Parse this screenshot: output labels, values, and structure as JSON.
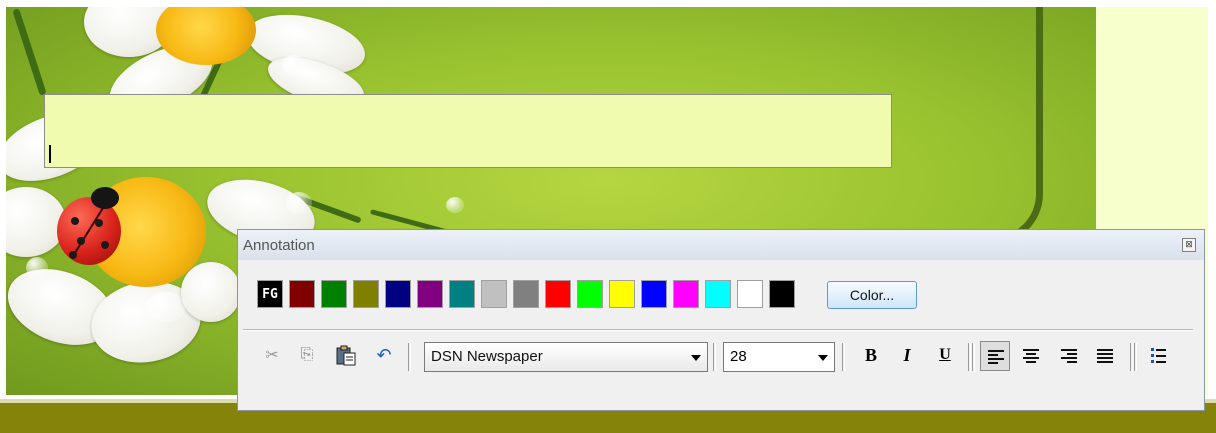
{
  "annotation_panel": {
    "title": "Annotation",
    "close_glyph": "⊠",
    "color_swatches": [
      {
        "label": "FG",
        "color": "#000000"
      },
      {
        "label": "",
        "color": "#800000"
      },
      {
        "label": "",
        "color": "#008000"
      },
      {
        "label": "",
        "color": "#808000"
      },
      {
        "label": "",
        "color": "#000080"
      },
      {
        "label": "",
        "color": "#800080"
      },
      {
        "label": "",
        "color": "#008080"
      },
      {
        "label": "",
        "color": "#c0c0c0"
      },
      {
        "label": "",
        "color": "#808080"
      },
      {
        "label": "",
        "color": "#ff0000"
      },
      {
        "label": "",
        "color": "#00ff00"
      },
      {
        "label": "",
        "color": "#ffff00"
      },
      {
        "label": "",
        "color": "#0000ff"
      },
      {
        "label": "",
        "color": "#ff00ff"
      },
      {
        "label": "",
        "color": "#00ffff"
      },
      {
        "label": "",
        "color": "#ffffff"
      },
      {
        "label": "",
        "color": "#000000"
      }
    ],
    "color_button_label": "Color...",
    "toolbar": {
      "cut_icon": "scissors-icon",
      "copy_icon": "copy-icon",
      "paste_icon": "paste-icon",
      "undo_icon": "undo-icon",
      "font_name": "DSN Newspaper",
      "font_size": "28",
      "bold_label": "B",
      "italic_label": "I",
      "underline_label": "U",
      "align_left_icon": "align-left-icon",
      "align_center_icon": "align-center-icon",
      "align_right_icon": "align-right-icon",
      "align_justify_icon": "align-justify-icon",
      "bullet_list_icon": "bullet-list-icon"
    }
  },
  "text_box": {
    "value": "",
    "background": "#f1fbb0"
  },
  "colors": {
    "scene_green": "#98c22f",
    "right_panel": "#f7ffcc",
    "bottom_strip": "#85830a"
  }
}
